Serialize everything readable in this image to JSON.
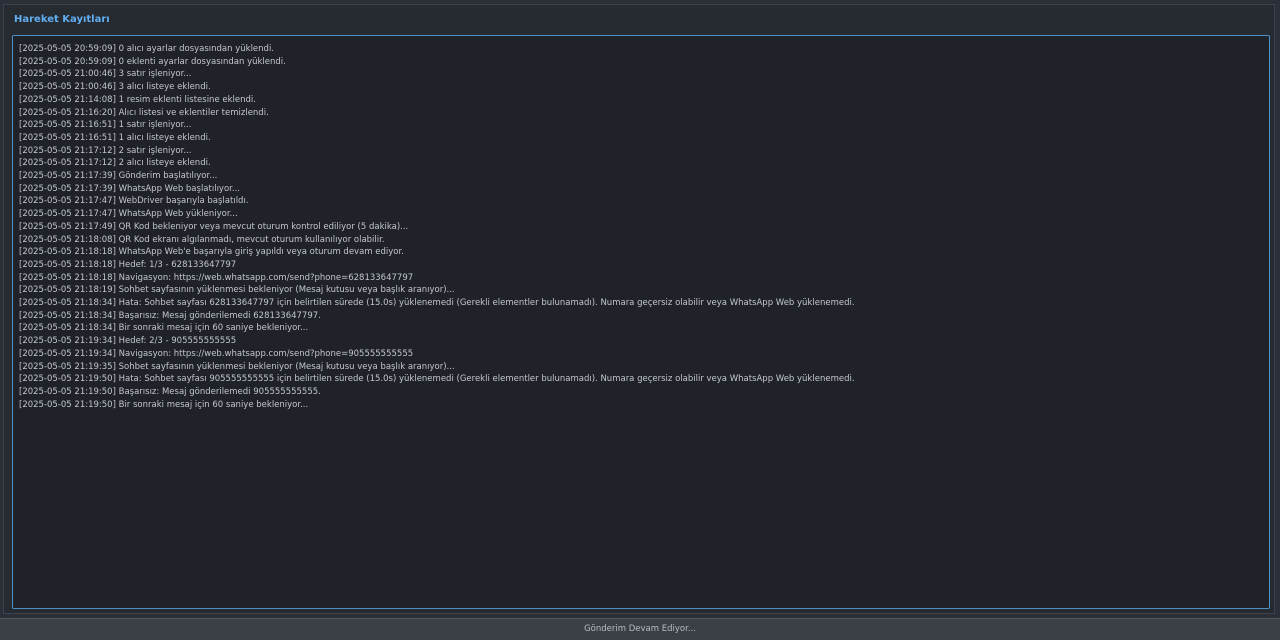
{
  "group": {
    "title": "Hareket Kayıtları"
  },
  "log": {
    "lines": [
      "[2025-05-05 20:59:09] 0 alıcı ayarlar dosyasından yüklendi.",
      "[2025-05-05 20:59:09] 0 eklenti ayarlar dosyasından yüklendi.",
      "[2025-05-05 21:00:46] 3 satır işleniyor...",
      "[2025-05-05 21:00:46] 3 alıcı listeye eklendi.",
      "[2025-05-05 21:14:08] 1 resim eklenti listesine eklendi.",
      "[2025-05-05 21:16:20] Alıcı listesi ve eklentiler temizlendi.",
      "[2025-05-05 21:16:51] 1 satır işleniyor...",
      "[2025-05-05 21:16:51] 1 alıcı listeye eklendi.",
      "[2025-05-05 21:17:12] 2 satır işleniyor...",
      "[2025-05-05 21:17:12] 2 alıcı listeye eklendi.",
      "[2025-05-05 21:17:39] Gönderim başlatılıyor...",
      "[2025-05-05 21:17:39] WhatsApp Web başlatılıyor...",
      "[2025-05-05 21:17:47] WebDriver başarıyla başlatıldı.",
      "[2025-05-05 21:17:47] WhatsApp Web yükleniyor...",
      "[2025-05-05 21:17:49] QR Kod bekleniyor veya mevcut oturum kontrol ediliyor (5 dakika)...",
      "[2025-05-05 21:18:08] QR Kod ekranı algılanmadı, mevcut oturum kullanılıyor olabilir.",
      "[2025-05-05 21:18:18] WhatsApp Web'e başarıyla giriş yapıldı veya oturum devam ediyor.",
      "[2025-05-05 21:18:18] Hedef: 1/3 - 628133647797",
      "[2025-05-05 21:18:18] Navigasyon: https://web.whatsapp.com/send?phone=628133647797",
      "[2025-05-05 21:18:19] Sohbet sayfasının yüklenmesi bekleniyor (Mesaj kutusu veya başlık aranıyor)...",
      "[2025-05-05 21:18:34] Hata: Sohbet sayfası 628133647797 için belirtilen sürede (15.0s) yüklenemedi (Gerekli elementler bulunamadı). Numara geçersiz olabilir veya WhatsApp Web yüklenemedi.",
      "[2025-05-05 21:18:34] Başarısız: Mesaj gönderilemedi 628133647797.",
      "[2025-05-05 21:18:34] Bir sonraki mesaj için 60 saniye bekleniyor...",
      "[2025-05-05 21:19:34] Hedef: 2/3 - 905555555555",
      "[2025-05-05 21:19:34] Navigasyon: https://web.whatsapp.com/send?phone=905555555555",
      "[2025-05-05 21:19:35] Sohbet sayfasının yüklenmesi bekleniyor (Mesaj kutusu veya başlık aranıyor)...",
      "[2025-05-05 21:19:50] Hata: Sohbet sayfası 905555555555 için belirtilen sürede (15.0s) yüklenemedi (Gerekli elementler bulunamadı). Numara geçersiz olabilir veya WhatsApp Web yüklenemedi.",
      "[2025-05-05 21:19:50] Başarısız: Mesaj gönderilemedi 905555555555.",
      "[2025-05-05 21:19:50] Bir sonraki mesaj için 60 saniye bekleniyor..."
    ]
  },
  "status": {
    "text": "Gönderim Devam Ediyor..."
  },
  "colors": {
    "title_accent": "#61aef0",
    "log_border": "#4e8fc6",
    "background": "#2b2f37"
  }
}
